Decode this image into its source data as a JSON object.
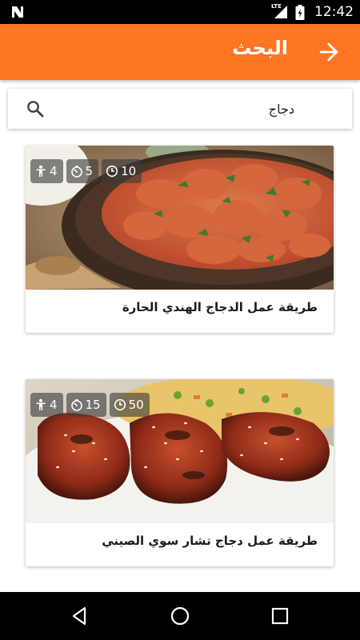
{
  "status_bar": {
    "network_label": "LTE",
    "time": "12:42"
  },
  "app_bar": {
    "title": "البحث",
    "back_icon": "arrow-back-icon",
    "color": "#fe7524"
  },
  "search": {
    "value": "دجاج",
    "icon": "search-icon"
  },
  "results": [
    {
      "title": "طريقة عمل الدجاج الهندي الحارة",
      "servings": "4",
      "prep_time": "5",
      "cook_time": "10"
    },
    {
      "title": "طريقة عمل دجاج تشار سوي الصيني",
      "servings": "4",
      "prep_time": "15",
      "cook_time": "50"
    }
  ],
  "nav_bar": {
    "back": "nav-back-icon",
    "home": "nav-home-icon",
    "recents": "nav-recents-icon"
  }
}
